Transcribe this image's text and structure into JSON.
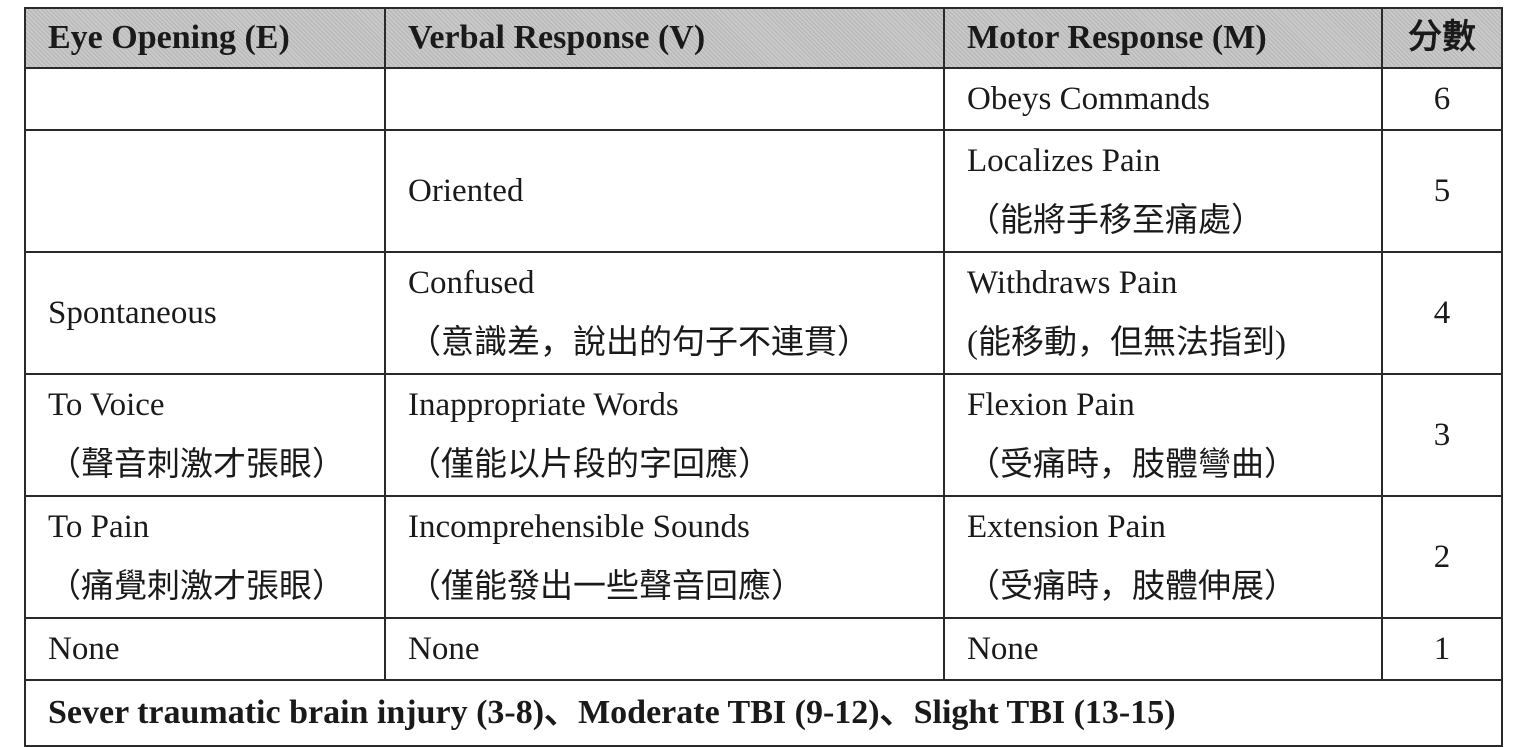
{
  "headers": {
    "eye": "Eye Opening (E)",
    "verbal": "Verbal Response (V)",
    "motor": "Motor Response (M)",
    "score": "分數"
  },
  "rows": [
    {
      "eye": [
        "",
        ""
      ],
      "verbal": [
        "",
        ""
      ],
      "motor": [
        "Obeys Commands",
        ""
      ],
      "score": "6"
    },
    {
      "eye": [
        "",
        ""
      ],
      "verbal": [
        "Oriented",
        ""
      ],
      "motor": [
        "Localizes Pain",
        "（能將手移至痛處）"
      ],
      "score": "5"
    },
    {
      "eye": [
        "Spontaneous",
        ""
      ],
      "verbal": [
        "Confused",
        "（意識差，說出的句子不連貫）"
      ],
      "motor": [
        "Withdraws Pain",
        "(能移動，但無法指到)"
      ],
      "score": "4"
    },
    {
      "eye": [
        "To Voice",
        "（聲音刺激才張眼）"
      ],
      "verbal": [
        "Inappropriate Words",
        "（僅能以片段的字回應）"
      ],
      "motor": [
        "Flexion Pain",
        "（受痛時，肢體彎曲）"
      ],
      "score": "3"
    },
    {
      "eye": [
        "To Pain",
        "（痛覺刺激才張眼）"
      ],
      "verbal": [
        "Incomprehensible Sounds",
        "（僅能發出一些聲音回應）"
      ],
      "motor": [
        "Extension Pain",
        "（受痛時，肢體伸展）"
      ],
      "score": "2"
    },
    {
      "eye": [
        "None",
        ""
      ],
      "verbal": [
        "None",
        ""
      ],
      "motor": [
        "None",
        ""
      ],
      "score": "1"
    }
  ],
  "footer": "Sever traumatic brain injury (3-8)、Moderate TBI (9-12)、Slight TBI (13-15)"
}
